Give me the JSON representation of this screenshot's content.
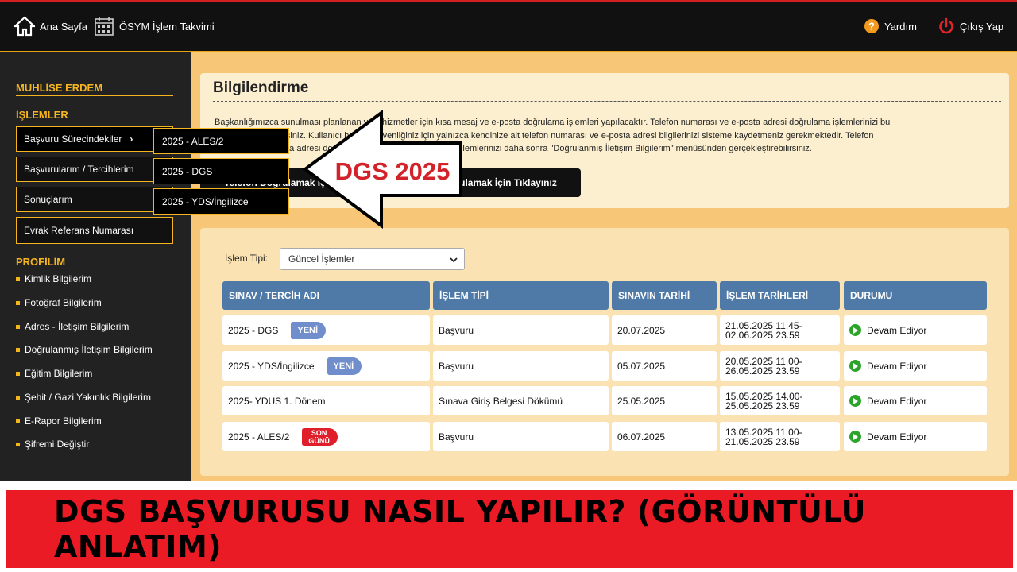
{
  "topbar": {
    "home_label": "Ana Sayfa",
    "calendar_label": "ÖSYM İşlem Takvimi",
    "help_label": "Yardım",
    "logout_label": "Çıkış Yap"
  },
  "sidebar": {
    "user_name": "MUHLİSE ERDEM",
    "operations_heading": "İŞLEMLER",
    "operations": [
      {
        "label": "Başvuru Sürecindekiler",
        "arrow": "›"
      },
      {
        "label": "Başvurularım / Tercihlerim"
      },
      {
        "label": "Sonuçlarım"
      },
      {
        "label": "Evrak Referans Numarası"
      }
    ],
    "profile_heading": "PROFİLİM",
    "profile_links": [
      "Kimlik Bilgilerim",
      "Fotoğraf Bilgilerim",
      "Adres - İletişim Bilgilerim",
      "Doğrulanmış İletişim Bilgilerim",
      "Eğitim Bilgilerim",
      "Şehit / Gazi Yakınlık Bilgilerim",
      "E-Rapor Bilgilerim",
      "Şifremi Değiştir"
    ]
  },
  "submenu": [
    "2025 - ALES/2",
    "2025 - DGS",
    "2025 - YDS/İngilizce"
  ],
  "info": {
    "title": "Bilgilendirme",
    "text_line1": "Başkanlığımızca sunulması planlanan yeni hizmetler için kısa mesaj ve e-posta doğrulama işlemleri yapılacaktır. Telefon numarası ve e-posta adresi doğrulama işlemlerinizi bu",
    "text_line2": "ekrandan yapabilirsiniz. Kullanıcı hesabı güvenliğiniz için yalnızca kendinize ait telefon numarası ve e-posta adresi bilgilerinizi sisteme kaydetmeniz gerekmektedir. Telefon",
    "text_line3": "numarası ve e-posta adresi doğrulama bilgilerinizi güncelleme işlemlerinizi daha sonra \"Doğrulanmış İletişim Bilgilerim\" menüsünden gerçekleştirebilirsiniz.",
    "phone_button": "Telefon Doğrulamak İçin Tıklayınız",
    "email_button": "E-Posta Doğrulamak İçin Tıklayınız"
  },
  "overlay_arrow_text": "DGS 2025",
  "filter": {
    "label": "İşlem Tipi:",
    "selected": "Güncel İşlemler"
  },
  "table": {
    "headers": [
      "SINAV / TERCİH ADI",
      "İŞLEM TİPİ",
      "SINAVIN TARİHİ",
      "İŞLEM TARİHLERİ",
      "DURUMU"
    ],
    "rows": [
      {
        "name": "2025 - DGS",
        "tag": "YENİ",
        "tag_color": "#6f8ecb",
        "type": "Başvuru",
        "exam_date": "20.07.2025",
        "dates_start": "21.05.2025 11.45-",
        "dates_end": "02.06.2025 23.59",
        "status": "Devam Ediyor"
      },
      {
        "name": "2025 - YDS/İngilizce",
        "tag": "YENİ",
        "tag_color": "#6f8ecb",
        "type": "Başvuru",
        "exam_date": "05.07.2025",
        "dates_start": "20.05.2025 11.00-",
        "dates_end": "26.05.2025 23.59",
        "status": "Devam Ediyor"
      },
      {
        "name": "2025- YDUS 1. Dönem",
        "tag": "",
        "type": "Sınava Giriş Belgesi Dökümü",
        "exam_date": "25.05.2025",
        "dates_start": "15.05.2025 14.00-",
        "dates_end": "25.05.2025 23.59",
        "status": "Devam Ediyor"
      },
      {
        "name": "2025 - ALES/2",
        "tag": "SON GÜNÜ",
        "tag_line1": "SON",
        "tag_line2": "GÜNÜ",
        "tag_color": "#e01e2a",
        "type": "Başvuru",
        "exam_date": "06.07.2025",
        "dates_start": "13.05.2025 11.00-",
        "dates_end": "21.05.2025 23.59",
        "status": "Devam Ediyor"
      }
    ]
  },
  "banner": {
    "text": "DGS BAŞVURUSU NASIL YAPILIR? (GÖRÜNTÜLÜ ANLATIM)"
  },
  "colors": {
    "accent": "#f4b521",
    "header": "#4f7aa8",
    "banner": "#ea1b24",
    "arrow_text": "#d2232a",
    "status": "#2aa52a"
  }
}
